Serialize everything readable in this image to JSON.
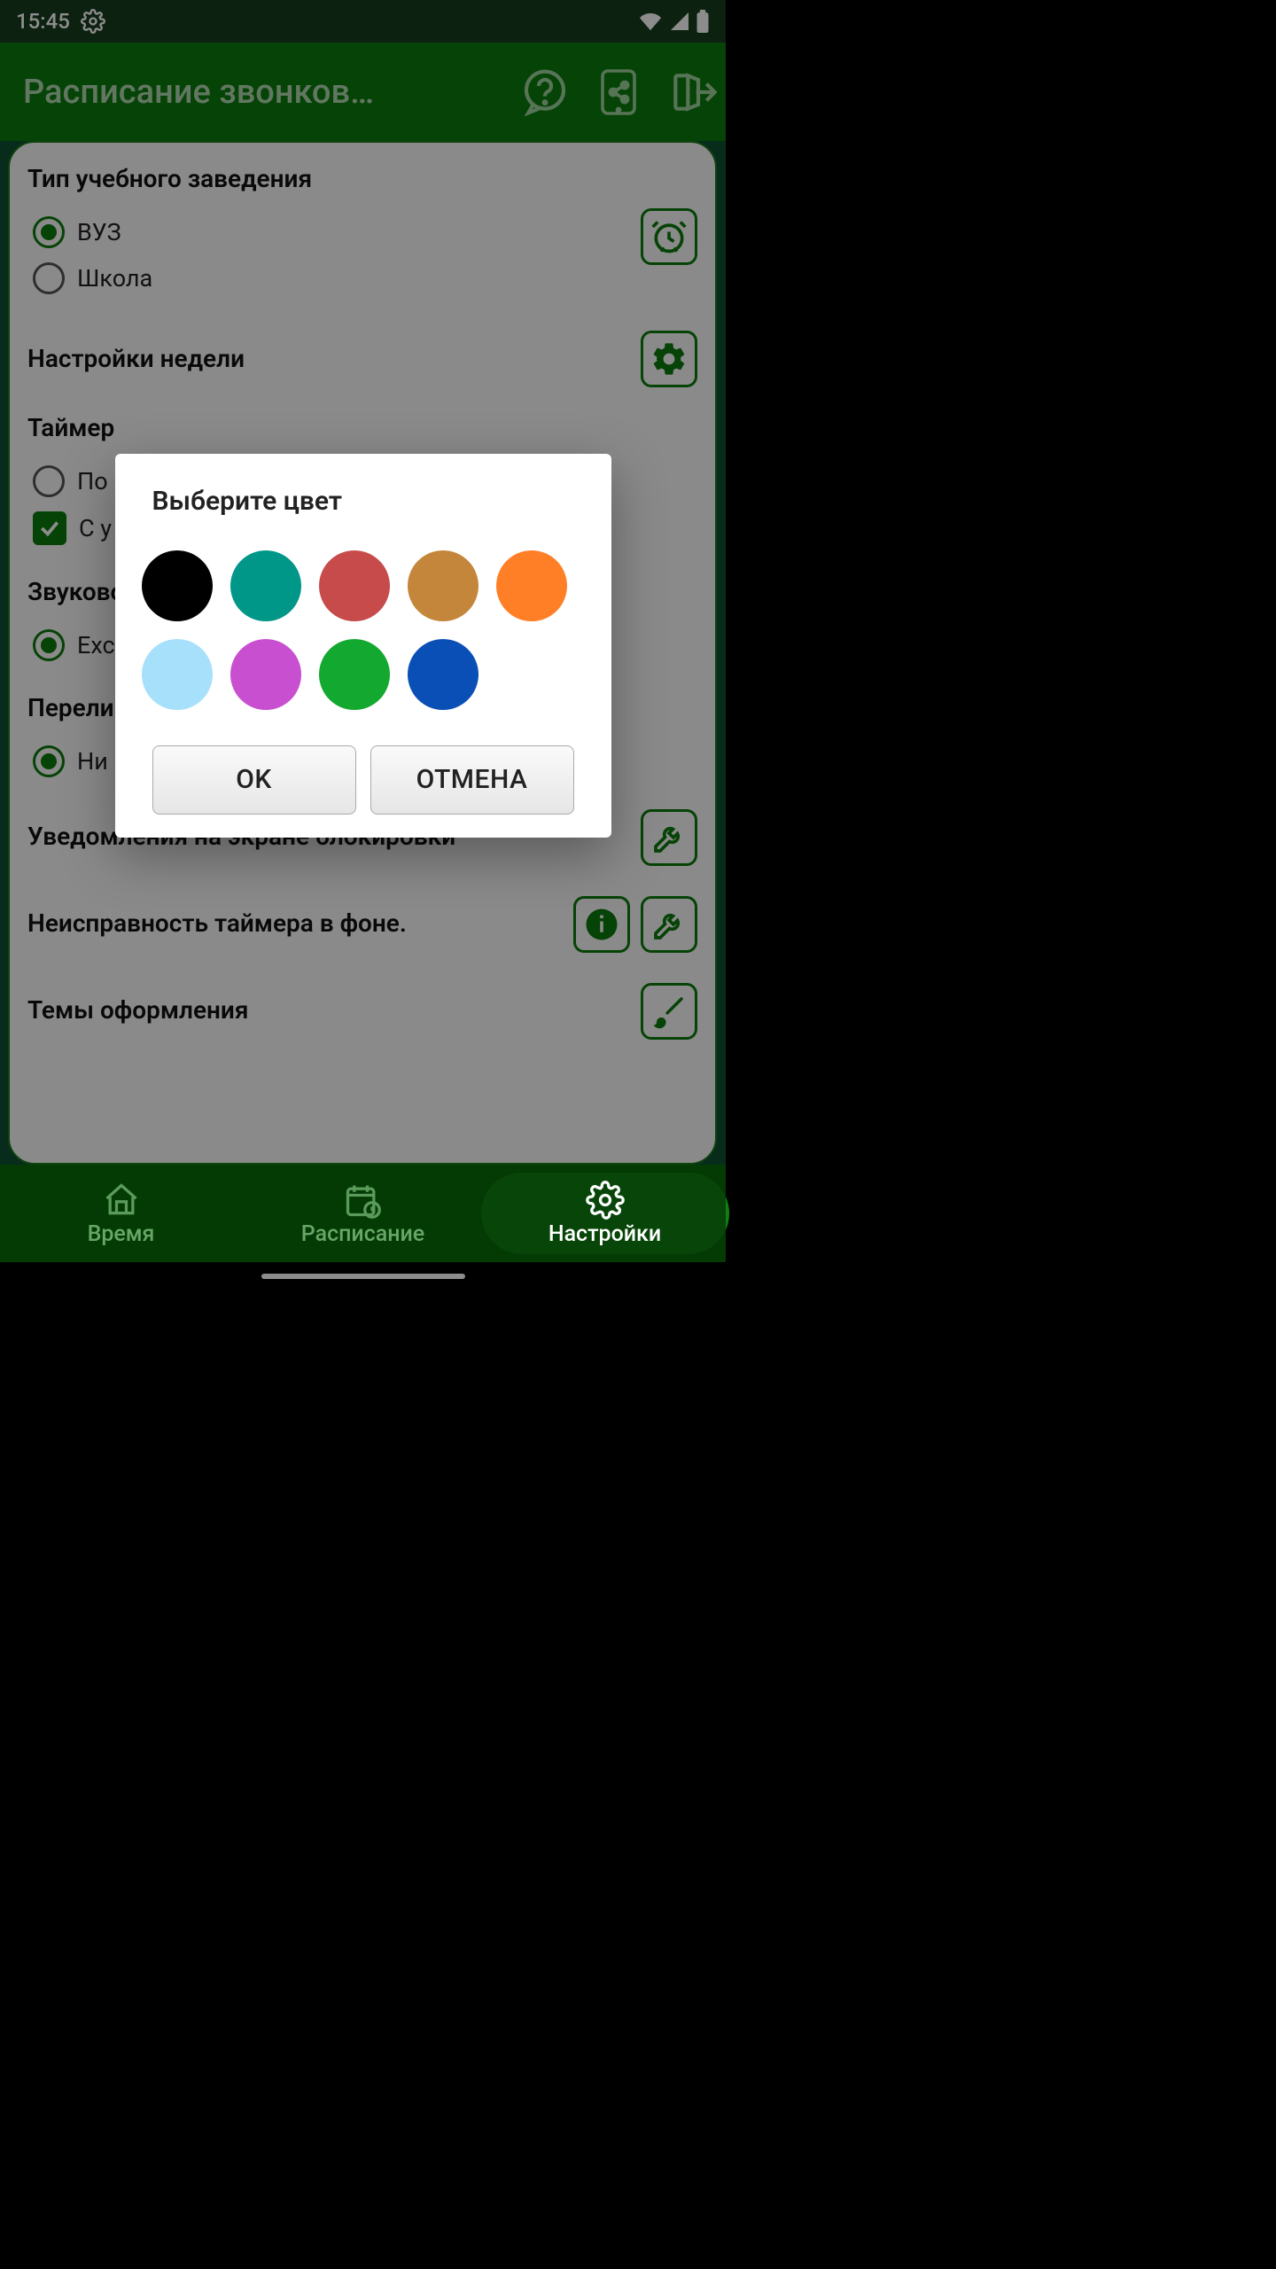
{
  "statusbar": {
    "time": "15:45"
  },
  "appbar": {
    "title": "Расписание звонков…"
  },
  "settings": {
    "institution": {
      "title": "Тип учебного заведения",
      "vuz": "ВУЗ",
      "school": "Школа"
    },
    "week": {
      "title": "Настройки недели"
    },
    "timer": {
      "title": "Таймер",
      "opt1": "По",
      "opt2": "С у"
    },
    "sound": {
      "title": "Звуково",
      "opt1": "Exc"
    },
    "gradient": {
      "title": "Перели",
      "opt1": "Ни"
    },
    "lockscreen": {
      "title": "Уведомления на экране блокировки"
    },
    "timerfault": {
      "title": "Неисправность таймера в фоне."
    },
    "themes": {
      "title": "Темы оформления"
    }
  },
  "bottomnav": {
    "time": "Время",
    "schedule": "Расписание",
    "settings": "Настройки"
  },
  "dialog": {
    "title": "Выберите цвет",
    "ok": "OK",
    "cancel": "ОТМЕНА",
    "colors": [
      "#000000",
      "#009688",
      "#c74b4b",
      "#c4863a",
      "#ff7f27",
      "#a6e0fb",
      "#c94fd1",
      "#13a82f",
      "#0a4fb5"
    ]
  }
}
